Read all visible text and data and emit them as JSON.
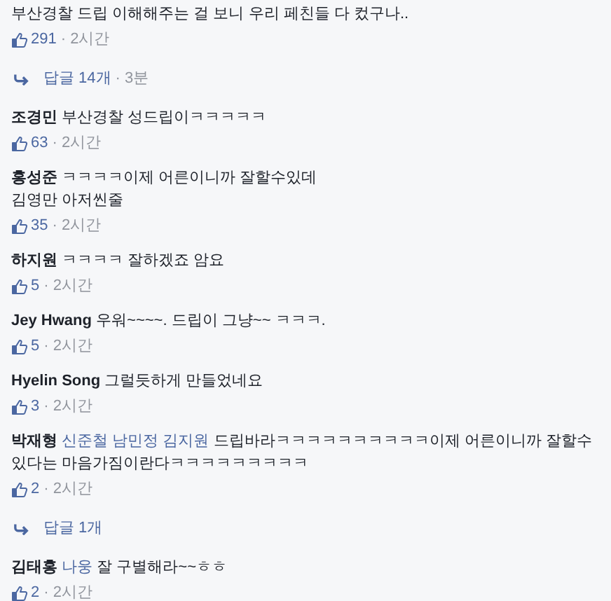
{
  "separator": "·",
  "items": [
    {
      "kind": "comment",
      "body": [
        {
          "kind": "text",
          "text": "부산경찰 드립 이해해주는 걸 보니 우리 페친들 다 컸구나.."
        }
      ],
      "likes": "291",
      "time": "2시간"
    },
    {
      "kind": "replies",
      "label": "답글 14개",
      "time": "3분"
    },
    {
      "kind": "comment",
      "author": "조경민",
      "body": [
        {
          "kind": "text",
          "text": "부산경찰 성드립이ㅋㅋㅋㅋㅋ"
        }
      ],
      "likes": "63",
      "time": "2시간"
    },
    {
      "kind": "comment",
      "author": "홍성준",
      "body": [
        {
          "kind": "text",
          "text": "ㅋㅋㅋㅋ이제 어른이니까 잘할수있데\n김영만 아저씬줄"
        }
      ],
      "likes": "35",
      "time": "2시간"
    },
    {
      "kind": "comment",
      "author": "하지원",
      "body": [
        {
          "kind": "text",
          "text": "ㅋㅋㅋㅋ 잘하겠죠 암요"
        }
      ],
      "likes": "5",
      "time": "2시간"
    },
    {
      "kind": "comment",
      "author": "Jey Hwang",
      "body": [
        {
          "kind": "text",
          "text": "우워~~~~. 드립이 그냥~~ ㅋㅋㅋ."
        }
      ],
      "likes": "5",
      "time": "2시간"
    },
    {
      "kind": "comment",
      "author": "Hyelin Song",
      "body": [
        {
          "kind": "text",
          "text": "그럴듯하게 만들었네요"
        }
      ],
      "likes": "3",
      "time": "2시간"
    },
    {
      "kind": "comment",
      "author": "박재형",
      "body": [
        {
          "kind": "tag",
          "text": "신준철"
        },
        {
          "kind": "tag",
          "text": "남민정"
        },
        {
          "kind": "tag",
          "text": "김지원"
        },
        {
          "kind": "text",
          "text": "드립바라ㅋㅋㅋㅋㅋㅋㅋㅋㅋㅋ이제 어른이니까 잘할수있다는 마음가짐이란다ㅋㅋㅋㅋㅋㅋㅋㅋㅋ"
        }
      ],
      "likes": "2",
      "time": "2시간"
    },
    {
      "kind": "replies",
      "label": "답글 1개"
    },
    {
      "kind": "comment",
      "author": "김태홍",
      "body": [
        {
          "kind": "tag",
          "text": "나웅"
        },
        {
          "kind": "text",
          "text": "잘 구별해라~~ㅎㅎ"
        }
      ],
      "likes": "2",
      "time": "2시간"
    }
  ]
}
